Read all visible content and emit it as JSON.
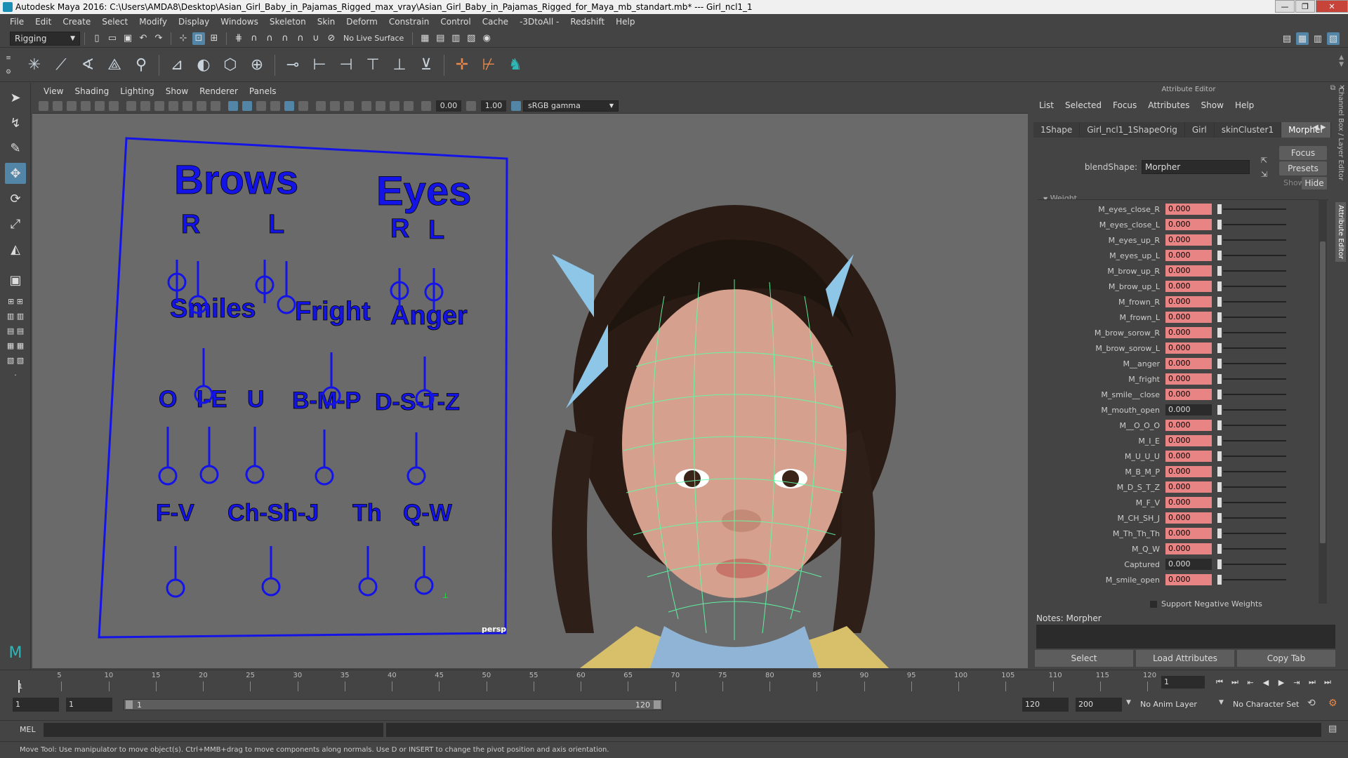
{
  "window": {
    "title": "Autodesk Maya 2016: C:\\Users\\AMDA8\\Desktop\\Asian_Girl_Baby_in_Pajamas_Rigged_max_vray\\Asian_Girl_Baby_in_Pajamas_Rigged_for_Maya_mb_standart.mb*   ---   Girl_ncl1_1",
    "controls": [
      "—",
      "❐",
      "✕"
    ]
  },
  "menubar": [
    "File",
    "Edit",
    "Create",
    "Select",
    "Modify",
    "Display",
    "Windows",
    "Skeleton",
    "Skin",
    "Deform",
    "Constrain",
    "Control",
    "Cache",
    "-3DtoAll -",
    "Redshift",
    "Help"
  ],
  "statusline": {
    "menuset": "Rigging",
    "live_surface": "No Live Surface"
  },
  "viewport": {
    "menu": [
      "View",
      "Shading",
      "Lighting",
      "Show",
      "Renderer",
      "Panels"
    ],
    "exposure": "0.00",
    "gamma": "1.00",
    "color_space": "sRGB gamma",
    "camera": "persp",
    "rig_labels": {
      "brows": "Brows",
      "eyes": "Eyes",
      "r1": "R",
      "l1": "L",
      "r2": "R",
      "l2": "L",
      "smiles": "Smiles",
      "fright": "Fright",
      "anger": "Anger",
      "o": "O",
      "ie": "I-E",
      "u": "U",
      "bmp": "B-M-P",
      "dstz": "D-S-T-Z",
      "fv": "F-V",
      "chshj": "Ch-Sh-J",
      "th": "Th",
      "qw": "Q-W"
    },
    "colors": {
      "rig": "#1414e6",
      "wire": "#5dffa6",
      "background": "#6a6a6a"
    }
  },
  "attribute_editor": {
    "header": "Attribute Editor",
    "menu": [
      "List",
      "Selected",
      "Focus",
      "Attributes",
      "Show",
      "Help"
    ],
    "tabs": [
      "1Shape",
      "Girl_ncl1_1ShapeOrig",
      "Girl",
      "skinCluster1",
      "Morpher"
    ],
    "active_tab": "Morpher",
    "blendshape_label": "blendShape:",
    "blendshape_value": "Morpher",
    "buttons": {
      "focus": "Focus",
      "presets": "Presets",
      "show": "Show",
      "hide": "Hide"
    },
    "section": "Weight",
    "weights": [
      {
        "name": "M_eyes_close_R",
        "value": "0.000",
        "keyed": true
      },
      {
        "name": "M_eyes_close_L",
        "value": "0.000",
        "keyed": true
      },
      {
        "name": "M_eyes_up_R",
        "value": "0.000",
        "keyed": true
      },
      {
        "name": "M_eyes_up_L",
        "value": "0.000",
        "keyed": true
      },
      {
        "name": "M_brow_up_R",
        "value": "0.000",
        "keyed": true
      },
      {
        "name": "M_brow_up_L",
        "value": "0.000",
        "keyed": true
      },
      {
        "name": "M_frown_R",
        "value": "0.000",
        "keyed": true
      },
      {
        "name": "M_frown_L",
        "value": "0.000",
        "keyed": true
      },
      {
        "name": "M_brow_sorow_R",
        "value": "0.000",
        "keyed": true
      },
      {
        "name": "M_brow_sorow_L",
        "value": "0.000",
        "keyed": true
      },
      {
        "name": "M__anger",
        "value": "0.000",
        "keyed": true
      },
      {
        "name": "M_fright",
        "value": "0.000",
        "keyed": true
      },
      {
        "name": "M_smile__close",
        "value": "0.000",
        "keyed": true
      },
      {
        "name": "M_mouth_open",
        "value": "0.000",
        "keyed": false
      },
      {
        "name": "M__O_O_O",
        "value": "0.000",
        "keyed": true
      },
      {
        "name": "M_I_E",
        "value": "0.000",
        "keyed": true
      },
      {
        "name": "M_U_U_U",
        "value": "0.000",
        "keyed": true
      },
      {
        "name": "M_B_M_P",
        "value": "0.000",
        "keyed": true
      },
      {
        "name": "M_D_S_T_Z",
        "value": "0.000",
        "keyed": true
      },
      {
        "name": "M_F_V",
        "value": "0.000",
        "keyed": true
      },
      {
        "name": "M_CH_SH_J",
        "value": "0.000",
        "keyed": true
      },
      {
        "name": "M_Th_Th_Th",
        "value": "0.000",
        "keyed": true
      },
      {
        "name": "M_Q_W",
        "value": "0.000",
        "keyed": true
      },
      {
        "name": "Captured",
        "value": "0.000",
        "keyed": false
      },
      {
        "name": "M_smile_open",
        "value": "0.000",
        "keyed": true
      }
    ],
    "support_negative": "Support Negative Weights",
    "notes_label": "Notes:  Morpher",
    "bottom_buttons": [
      "Select",
      "Load Attributes",
      "Copy Tab"
    ],
    "side_tabs": [
      "Channel Box / Layer Editor",
      "Attribute Editor"
    ]
  },
  "timeline": {
    "ticks": [
      "5",
      "10",
      "15",
      "20",
      "25",
      "30",
      "35",
      "40",
      "45",
      "50",
      "55",
      "60",
      "65",
      "70",
      "75",
      "80",
      "85",
      "90",
      "95",
      "100",
      "105",
      "110",
      "115",
      "120"
    ],
    "start_label": "1",
    "current_frame": "1",
    "play_controls": [
      "⏮",
      "⏭",
      "⇤",
      "◀",
      "▶",
      "⇥",
      "⏭",
      "⏭"
    ]
  },
  "range": {
    "start": "1",
    "inner_start": "1",
    "range_start_label": "1",
    "range_end_label": "120",
    "end": "120",
    "anim_end": "200",
    "anim_layer": "No Anim Layer",
    "character_set": "No Character Set"
  },
  "cmdline": {
    "label": "MEL"
  },
  "helpline": {
    "text": "Move Tool: Use manipulator to move object(s). Ctrl+MMB+drag to move components along normals. Use D or INSERT to change the pivot position and axis orientation."
  }
}
